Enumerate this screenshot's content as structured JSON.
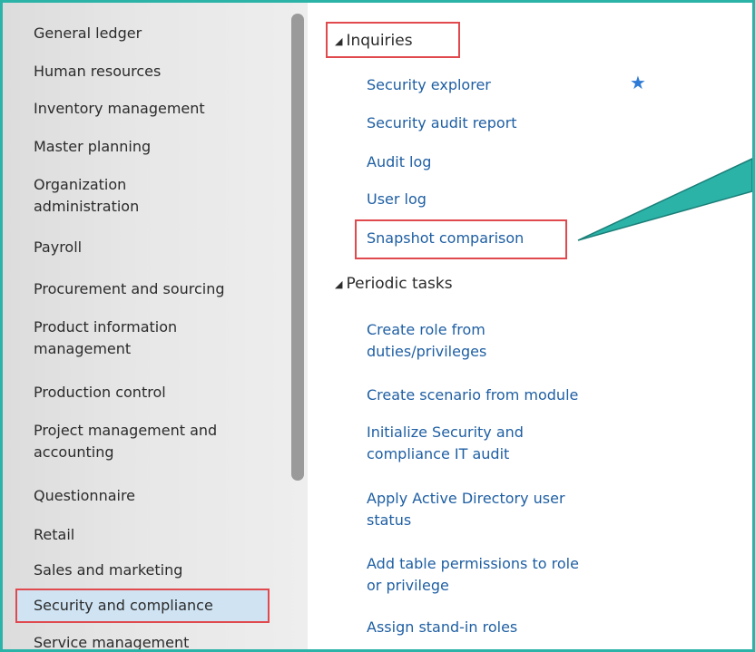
{
  "sidebar": {
    "items": [
      {
        "label": "General ledger"
      },
      {
        "label": "Human resources"
      },
      {
        "label": "Inventory management"
      },
      {
        "label": "Master planning"
      },
      {
        "label": "Organization administration"
      },
      {
        "label": "Payroll"
      },
      {
        "label": "Procurement and sourcing"
      },
      {
        "label": "Product information management"
      },
      {
        "label": "Production control"
      },
      {
        "label": "Project management and accounting"
      },
      {
        "label": "Questionnaire"
      },
      {
        "label": "Retail"
      },
      {
        "label": "Sales and marketing"
      },
      {
        "label": "Security and compliance"
      },
      {
        "label": "Service management"
      }
    ],
    "selected": "Security and compliance"
  },
  "groups": [
    {
      "title": "Inquiries",
      "links": [
        {
          "label": "Security explorer",
          "favorite": true
        },
        {
          "label": "Security audit report"
        },
        {
          "label": "Audit log"
        },
        {
          "label": "User log"
        },
        {
          "label": "Snapshot comparison"
        }
      ]
    },
    {
      "title": "Periodic tasks",
      "links": [
        {
          "label": "Create role from duties/privileges"
        },
        {
          "label": "Create scenario from module"
        },
        {
          "label": "Initialize Security and compliance IT audit"
        },
        {
          "label": "Apply Active Directory user status"
        },
        {
          "label": "Add table permissions to role or privilege"
        },
        {
          "label": "Assign stand-in roles"
        }
      ]
    }
  ],
  "icons": {
    "collapse": "triangle-down-icon",
    "favorite": "star-icon"
  },
  "colors": {
    "link": "#1f5fa3",
    "highlight_border": "#e0494e",
    "selected_bg": "#cfe3f3",
    "frame": "#2bb3a8",
    "star": "#2e7bd6"
  }
}
